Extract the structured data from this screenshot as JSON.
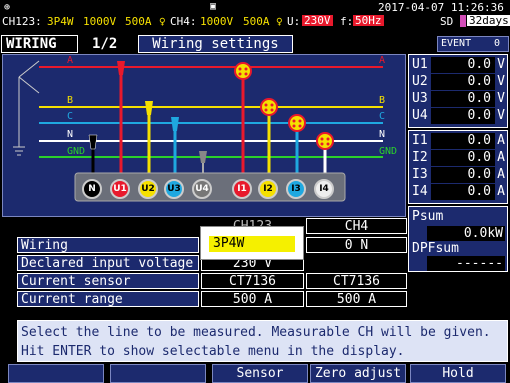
{
  "status": {
    "channel_info_prefix": "CH123:",
    "wiring_short": "3P4W",
    "voltage_range": "1000V",
    "current_range": "500A",
    "ch4_prefix": "CH4:",
    "ch4_voltage": "1000V",
    "ch4_current": "500A",
    "u_label": "U:",
    "u_value": "230V",
    "f_label": "f:",
    "f_value": "50Hz",
    "datetime": "2017-04-07 11:26:36",
    "sd_label": "SD",
    "sd_days": "32days",
    "event_label": "EVENT",
    "event_count": "0"
  },
  "titlebar": {
    "screen": "WIRING",
    "page": "1/2",
    "title": "Wiring settings"
  },
  "diagram": {
    "line_labels_left": [
      "A",
      "B",
      "C",
      "N",
      "GND"
    ],
    "line_labels_right": [
      "A",
      "B",
      "C",
      "N",
      "GND"
    ],
    "terminals": [
      "N",
      "U1",
      "U2",
      "U3",
      "U4",
      "I1",
      "I2",
      "I3",
      "I4"
    ]
  },
  "meters": {
    "voltage": [
      {
        "label": "U1",
        "value": "0.0",
        "unit": "V"
      },
      {
        "label": "U2",
        "value": "0.0",
        "unit": "V"
      },
      {
        "label": "U3",
        "value": "0.0",
        "unit": "V"
      },
      {
        "label": "U4",
        "value": "0.0",
        "unit": "V"
      }
    ],
    "current": [
      {
        "label": "I1",
        "value": "0.0",
        "unit": "A"
      },
      {
        "label": "I2",
        "value": "0.0",
        "unit": "A"
      },
      {
        "label": "I3",
        "value": "0.0",
        "unit": "A"
      },
      {
        "label": "I4",
        "value": "0.0",
        "unit": "A"
      }
    ],
    "psum_label": "Psum",
    "psum_value": "0.0kW",
    "dpf_label": "DPFsum",
    "dpf_value": "------"
  },
  "table": {
    "col1_header": "CH123",
    "col2_header": "CH4",
    "rows": [
      {
        "label": "Wiring",
        "v1": "3P4W",
        "v2": "0 N"
      },
      {
        "label": "Declared input voltage",
        "v1": "230 V",
        "v2": ""
      },
      {
        "label": "Current sensor",
        "v1": "CT7136",
        "v2": "CT7136"
      },
      {
        "label": "Current range",
        "v1": "500 A",
        "v2": "500 A"
      }
    ]
  },
  "hint": {
    "line1": "Select the line to be measured. Measurable CH will be given.",
    "line2": "Hit ENTER to show selectable menu in the display."
  },
  "fkeys": [
    "",
    "",
    "Sensor",
    "Zero adjust",
    "Hold"
  ],
  "colors": {
    "navy": "#1c2a6e",
    "red": "#e8192c",
    "yellow": "#f5e000",
    "cyan": "#1fa8e0",
    "green": "#2bd12b",
    "highlight": "#f5f000"
  }
}
